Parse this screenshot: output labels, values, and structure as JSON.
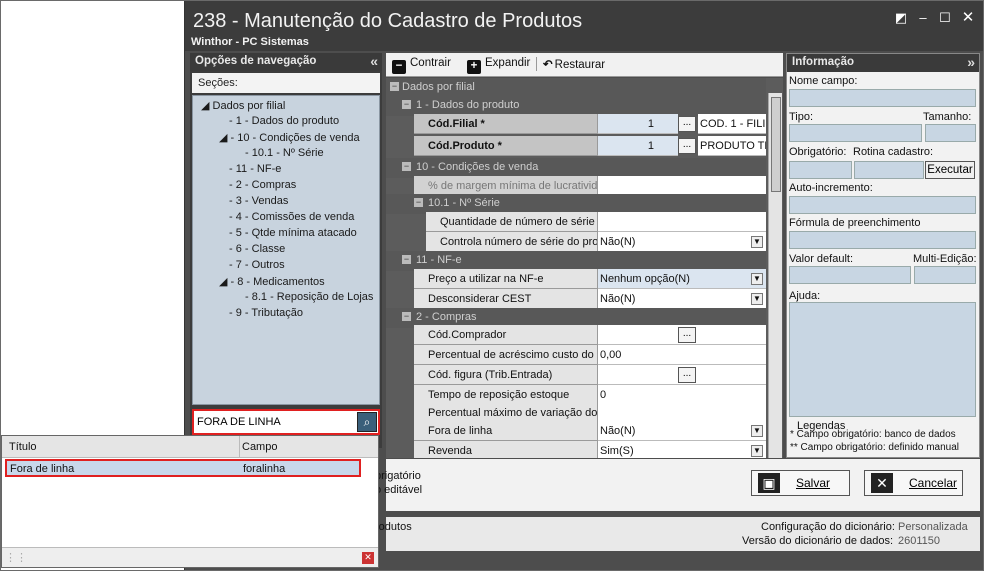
{
  "window": {
    "title": "238 - Manutenção do Cadastro de Produtos",
    "subtitle": "Winthor - PC Sistemas"
  },
  "nav": {
    "header": "Opções de navegação",
    "sections_label": "Seções:",
    "tree": [
      "Dados por filial",
      "1 - Dados do produto",
      "10 - Condições de venda",
      "10.1 - Nº Série",
      "11 - NF-e",
      "2 - Compras",
      "3 - Vendas",
      "4 - Comissões de venda",
      "5 - Qtde mínima atacado",
      "6 - Classe",
      "7 - Outros",
      "8 - Medicamentos",
      "8.1 - Reposição de Lojas",
      "9 - Tributação"
    ],
    "search_value": "FORA DE LINHA"
  },
  "toolbar": {
    "collapse": "Contrair",
    "expand": "Expandir",
    "restore": "Restaurar"
  },
  "grid": {
    "root": "Dados por filial",
    "cat1": "1 - Dados do produto",
    "cod_filial_label": "Cód.Filial *",
    "cod_filial_value": "1",
    "cod_filial_desc": "COD. 1 - FILI",
    "cod_produto_label": "Cód.Produto *",
    "cod_produto_value": "1",
    "cod_produto_desc": "PRODUTO TE",
    "cat10": "10 - Condições de venda",
    "margem_label": "% de margem mínima de lucratividade",
    "cat101": "10.1 - Nº Série",
    "qtd_serie_label": "Quantidade de número de série",
    "controla_serie_label": "Controla número de série do produto",
    "controla_serie_value": "Não(N)",
    "cat11": "11 - NF-e",
    "preco_nfe_label": "Preço a utilizar na NF-e",
    "preco_nfe_value": "Nenhum opção(N)",
    "cest_label": "Desconsiderar CEST",
    "cest_value": "Não(N)",
    "cat2": "2 - Compras",
    "comprador_label": "Cód.Comprador",
    "acrescimo_label": "Percentual de acréscimo custo do produto",
    "acrescimo_value": "0,00",
    "figura_label": "Cód. figura (Trib.Entrada)",
    "reposicao_label": "Tempo de reposição estoque",
    "reposicao_value": "0",
    "variacao_label": "Percentual máximo de variação do custo",
    "fora_linha_label": "Fora de linha",
    "fora_linha_value": "Não(N)",
    "revenda_label": "Revenda",
    "revenda_value": "Sim(S)"
  },
  "info": {
    "header": "Informação",
    "nome_campo": "Nome campo:",
    "tipo": "Tipo:",
    "tamanho": "Tamanho:",
    "obrigatorio": "Obrigatório:",
    "rotina": "Rotina cadastro:",
    "executar": "Executar",
    "auto_incremento": "Auto-incremento:",
    "formula": "Fórmula de preenchimento",
    "valor_default": "Valor default:",
    "multi_edicao": "Multi-Edição:",
    "ajuda": "Ajuda:",
    "legendas": "Legendas",
    "legenda1": "* Campo obrigatório: banco de dados",
    "legenda2": "** Campo obrigatório: definido manual"
  },
  "lower": {
    "legend_a": "brigatório",
    "legend_b": "o editável",
    "save": "Salvar",
    "cancel": "Cancelar"
  },
  "status": {
    "left": "rodutos",
    "config_label": "Configuração do dicionário:",
    "config_value": "Personalizada",
    "version_label": "Versão do dicionário de dados:",
    "version_value": "2601150"
  },
  "popup": {
    "col_title": "Título",
    "col_field": "Campo",
    "row_title": "Fora de linha",
    "row_field": "foralinha"
  }
}
